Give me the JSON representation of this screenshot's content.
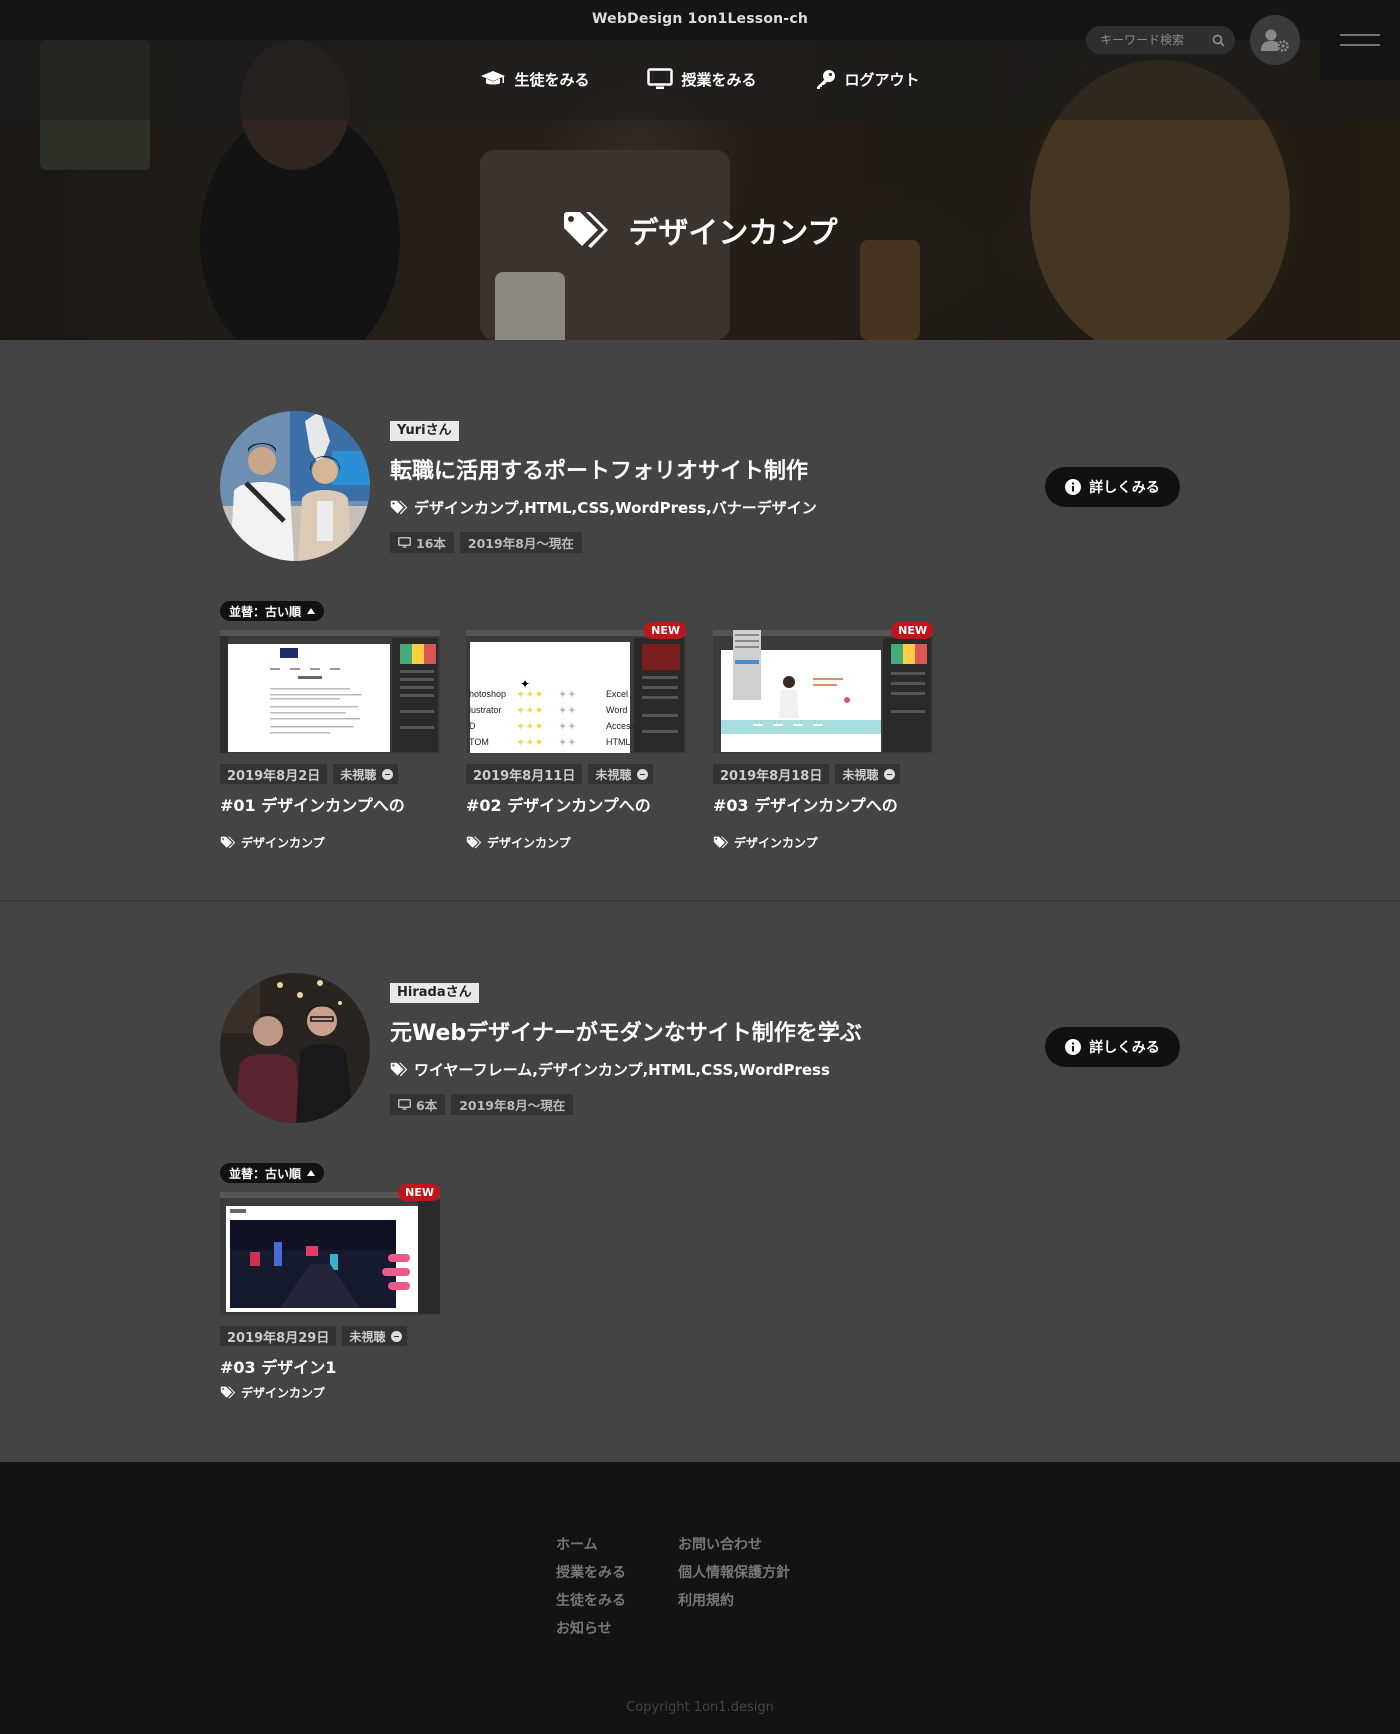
{
  "header": {
    "site_title": "WebDesign 1on1Lesson-ch",
    "nav": [
      {
        "label": "生徒をみる",
        "icon": "graduation-cap-icon"
      },
      {
        "label": "授業をみる",
        "icon": "monitor-icon"
      },
      {
        "label": "ログアウト",
        "icon": "key-icon"
      }
    ],
    "search_placeholder": "キーワード検索",
    "page_heading": "デザインカンプ"
  },
  "students": [
    {
      "name": "Yuriさん",
      "title": "転職に活用するポートフォリオサイト制作",
      "tags": "デザインカンプ,HTML,CSS,WordPress,バナーデザイン",
      "lesson_count": "16本",
      "period": "2019年8月〜現在",
      "detail_label": "詳しくみる",
      "sort_label": "並替：古い順",
      "lessons": [
        {
          "date": "2019年8月2日",
          "status": "未視聴",
          "title": "#01 デザインカンプへの",
          "tag": "デザインカンプ",
          "is_new": false,
          "new_label": ""
        },
        {
          "date": "2019年8月11日",
          "status": "未視聴",
          "title": "#02 デザインカンプへの",
          "tag": "デザインカンプ",
          "is_new": true,
          "new_label": "NEW",
          "skills": [
            "hotoshop",
            "lustrator",
            "D",
            "TOM"
          ],
          "skills_right": [
            "Excel",
            "Word",
            "Access",
            "HTML"
          ]
        },
        {
          "date": "2019年8月18日",
          "status": "未視聴",
          "title": "#03 デザインカンプへの",
          "tag": "デザインカンプ",
          "is_new": true,
          "new_label": "NEW"
        }
      ]
    },
    {
      "name": "Hiradaさん",
      "title": "元Webデザイナーがモダンなサイト制作を学ぶ",
      "tags": "ワイヤーフレーム,デザインカンプ,HTML,CSS,WordPress",
      "lesson_count": "6本",
      "period": "2019年8月〜現在",
      "detail_label": "詳しくみる",
      "sort_label": "並替：古い順",
      "lessons": [
        {
          "date": "2019年8月29日",
          "status": "未視聴",
          "title": "#03 デザイン1",
          "tag": "デザインカンプ",
          "is_new": true,
          "new_label": "NEW"
        }
      ]
    }
  ],
  "footer": {
    "col1": [
      "ホーム",
      "授業をみる",
      "生徒をみる",
      "お知らせ"
    ],
    "col2": [
      "お問い合わせ",
      "個人情報保護方針",
      "利用規約"
    ],
    "copyright": "Copyright 1on1.design"
  }
}
